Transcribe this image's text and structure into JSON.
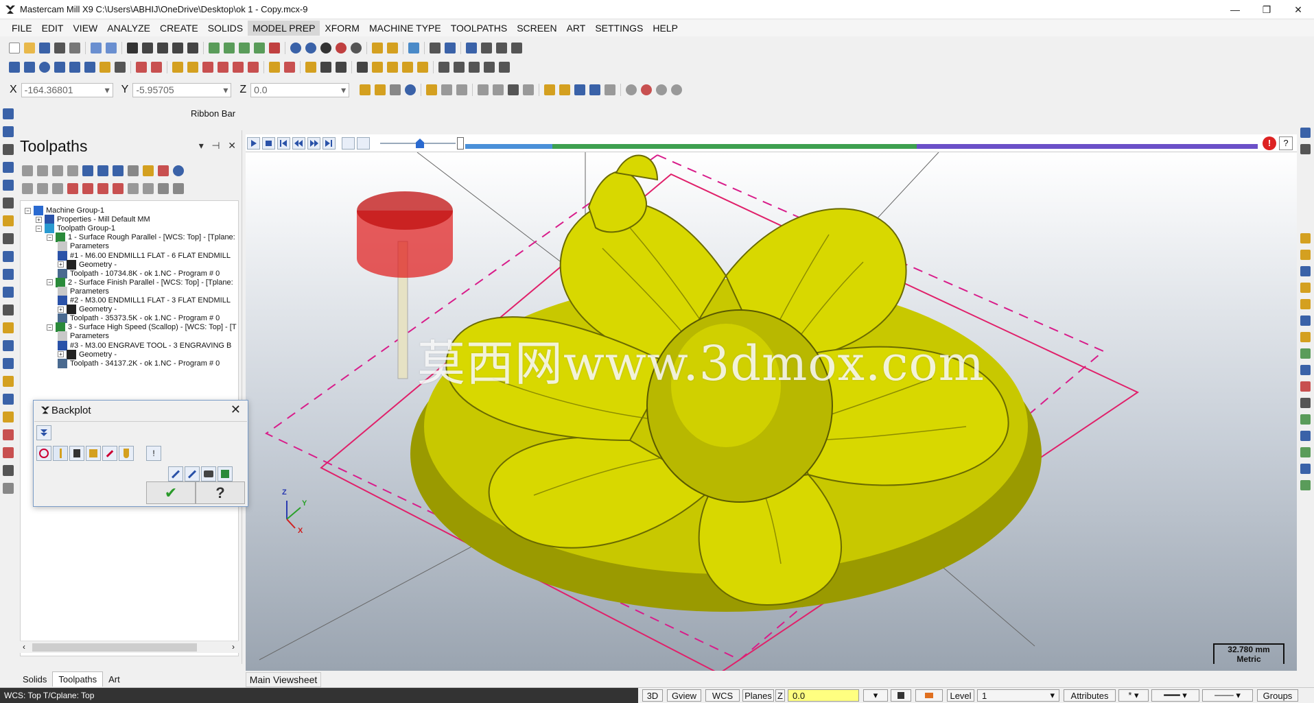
{
  "window": {
    "title": "Mastercam Mill X9  C:\\Users\\ABHIJ\\OneDrive\\Desktop\\ok 1 - Copy.mcx-9",
    "controls": [
      "minimize-icon",
      "restore-icon",
      "close-icon"
    ]
  },
  "menu": {
    "items": [
      "FILE",
      "EDIT",
      "VIEW",
      "ANALYZE",
      "CREATE",
      "SOLIDS",
      "MODEL PREP",
      "XFORM",
      "MACHINE TYPE",
      "TOOLPATHS",
      "SCREEN",
      "ART",
      "SETTINGS",
      "HELP"
    ],
    "active": "MODEL PREP"
  },
  "coords": {
    "x_label": "X",
    "x_value": "-164.36801",
    "y_label": "Y",
    "y_value": "-5.95705",
    "z_label": "Z",
    "z_value": "0.0"
  },
  "ribbon_bar_label": "Ribbon Bar",
  "toolpaths_panel": {
    "title": "Toolpaths",
    "tree": [
      {
        "text": "Machine Group-1",
        "icon": "machine-group-icon",
        "indent": 0
      },
      {
        "text": "Properties - Mill Default MM",
        "icon": "properties-icon",
        "indent": 1
      },
      {
        "text": "Toolpath Group-1",
        "icon": "toolpath-group-icon",
        "indent": 1
      },
      {
        "text": "1 - Surface Rough Parallel - [WCS: Top] - [Tplane:",
        "icon": "operation-icon",
        "indent": 2
      },
      {
        "text": "Parameters",
        "icon": "folder-icon",
        "indent": 3
      },
      {
        "text": "#1 - M6.00 ENDMILL1 FLAT - 6 FLAT ENDMILL",
        "icon": "tool-icon",
        "indent": 3
      },
      {
        "text": "Geometry -",
        "icon": "geometry-icon",
        "indent": 3
      },
      {
        "text": "Toolpath - 10734.8K - ok 1.NC - Program # 0",
        "icon": "toolpath-icon",
        "indent": 3
      },
      {
        "text": "2 - Surface Finish Parallel - [WCS: Top] - [Tplane:",
        "icon": "operation-icon",
        "indent": 2
      },
      {
        "text": "Parameters",
        "icon": "folder-icon",
        "indent": 3
      },
      {
        "text": "#2 - M3.00 ENDMILL1 FLAT - 3 FLAT ENDMILL",
        "icon": "tool-icon",
        "indent": 3
      },
      {
        "text": "Geometry -",
        "icon": "geometry-icon",
        "indent": 3
      },
      {
        "text": "Toolpath - 35373.5K - ok 1.NC - Program # 0",
        "icon": "toolpath-icon",
        "indent": 3
      },
      {
        "text": "3 - Surface High Speed (Scallop) - [WCS: Top] - [T",
        "icon": "operation-icon",
        "indent": 2
      },
      {
        "text": "Parameters",
        "icon": "folder-icon",
        "indent": 3
      },
      {
        "text": "#3 - M3.00 ENGRAVE TOOL - 3 ENGRAVING B",
        "icon": "tool-icon",
        "indent": 3
      },
      {
        "text": "Geometry -",
        "icon": "geometry-icon",
        "indent": 3
      },
      {
        "text": "Toolpath - 34137.2K - ok 1.NC - Program # 0",
        "icon": "toolpath-icon",
        "indent": 3
      }
    ]
  },
  "bottom_tabs": [
    "Solids",
    "Toolpaths",
    "Art"
  ],
  "bottom_tab_active": "Toolpaths",
  "backplot": {
    "title": "Backplot",
    "ok_glyph": "✔",
    "help_glyph": "?"
  },
  "viewport": {
    "tab": "Main Viewsheet",
    "watermark": "莫西网www.3dmox.com",
    "scale_value": "32.780 mm",
    "scale_unit": "Metric",
    "triad": {
      "z": "Z",
      "y": "Y",
      "x": "X"
    },
    "progress_segments": [
      {
        "color": "#4a90d9",
        "fraction": 0.11
      },
      {
        "color": "#3ea050",
        "fraction": 0.46
      },
      {
        "color": "#6b50c8",
        "fraction": 0.43
      }
    ]
  },
  "status": {
    "text": "WCS: Top  T/Cplane: Top",
    "buttons": [
      "3D",
      "Gview",
      "WCS",
      "Planes"
    ],
    "z_label": "Z",
    "z_value": "0.0",
    "level_label": "Level",
    "level_value": "1",
    "attributes_label": "Attributes",
    "groups_label": "Groups"
  },
  "colors": {
    "model_yellow": "#d4d400",
    "stock_box": "#e0206a",
    "tool_red": "#e01818"
  }
}
